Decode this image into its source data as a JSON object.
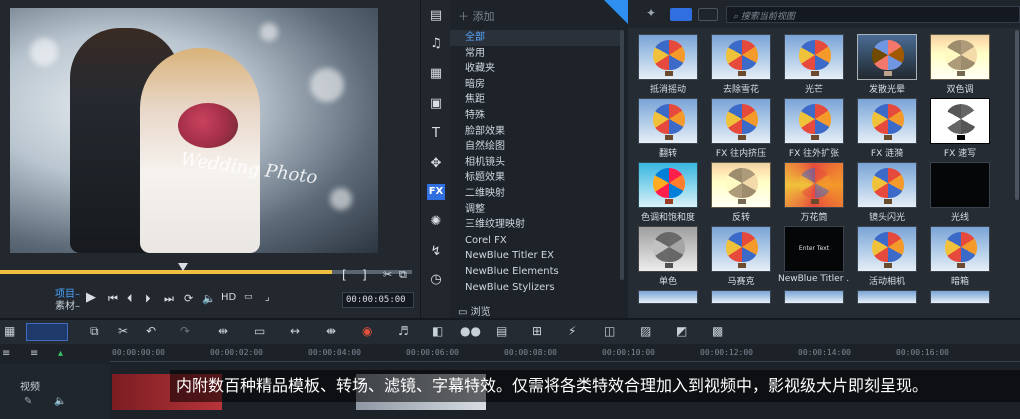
{
  "preview": {
    "overlay_text": "Wedding Photo",
    "mode_project": "项目–",
    "mode_clip": "素材–",
    "hd_label": "HD",
    "timecode": "00:00:05:00"
  },
  "library": {
    "add_label": "添加",
    "browse_label": "浏览",
    "categories": [
      "全部",
      "常用",
      "收藏夹",
      "暗房",
      "焦距",
      "特殊",
      "脸部效果",
      "自然绘图",
      "相机镜头",
      "标题效果",
      "二维映射",
      "调整",
      "三维纹理映射",
      "Corel FX",
      "NewBlue Titler EX",
      "NewBlue Elements",
      "NewBlue Stylizers"
    ],
    "selected_index": 0
  },
  "effects": {
    "search_placeholder": "搜索当前视图",
    "items": [
      "抵消摇动",
      "去除雪花",
      "光芒",
      "发散光晕",
      "双色调",
      "翻转",
      "FX 往内挤压",
      "FX 往外扩张",
      "FX 涟漪",
      "FX 速写",
      "色调和饱和度",
      "反转",
      "万花筒",
      "镜头闪光",
      "光线",
      "单色",
      "马赛克",
      "NewBlue Titler ...",
      "活动相机",
      "暗箱"
    ],
    "titler_thumb_text": "Enter Text"
  },
  "timeline": {
    "ticks": [
      "00:00:00:00",
      "00:00:02:00",
      "00:00:04:00",
      "00:00:06:00",
      "00:00:08:00",
      "00:00:10:00",
      "00:00:12:00",
      "00:00:14:00",
      "00:00:16:00"
    ],
    "track_label": "视频"
  },
  "banner": "内附数百种精品模板、转场、滤镜、字幕特效。仅需将各类特效合理加入到视频中，影视级大片即刻呈现。"
}
